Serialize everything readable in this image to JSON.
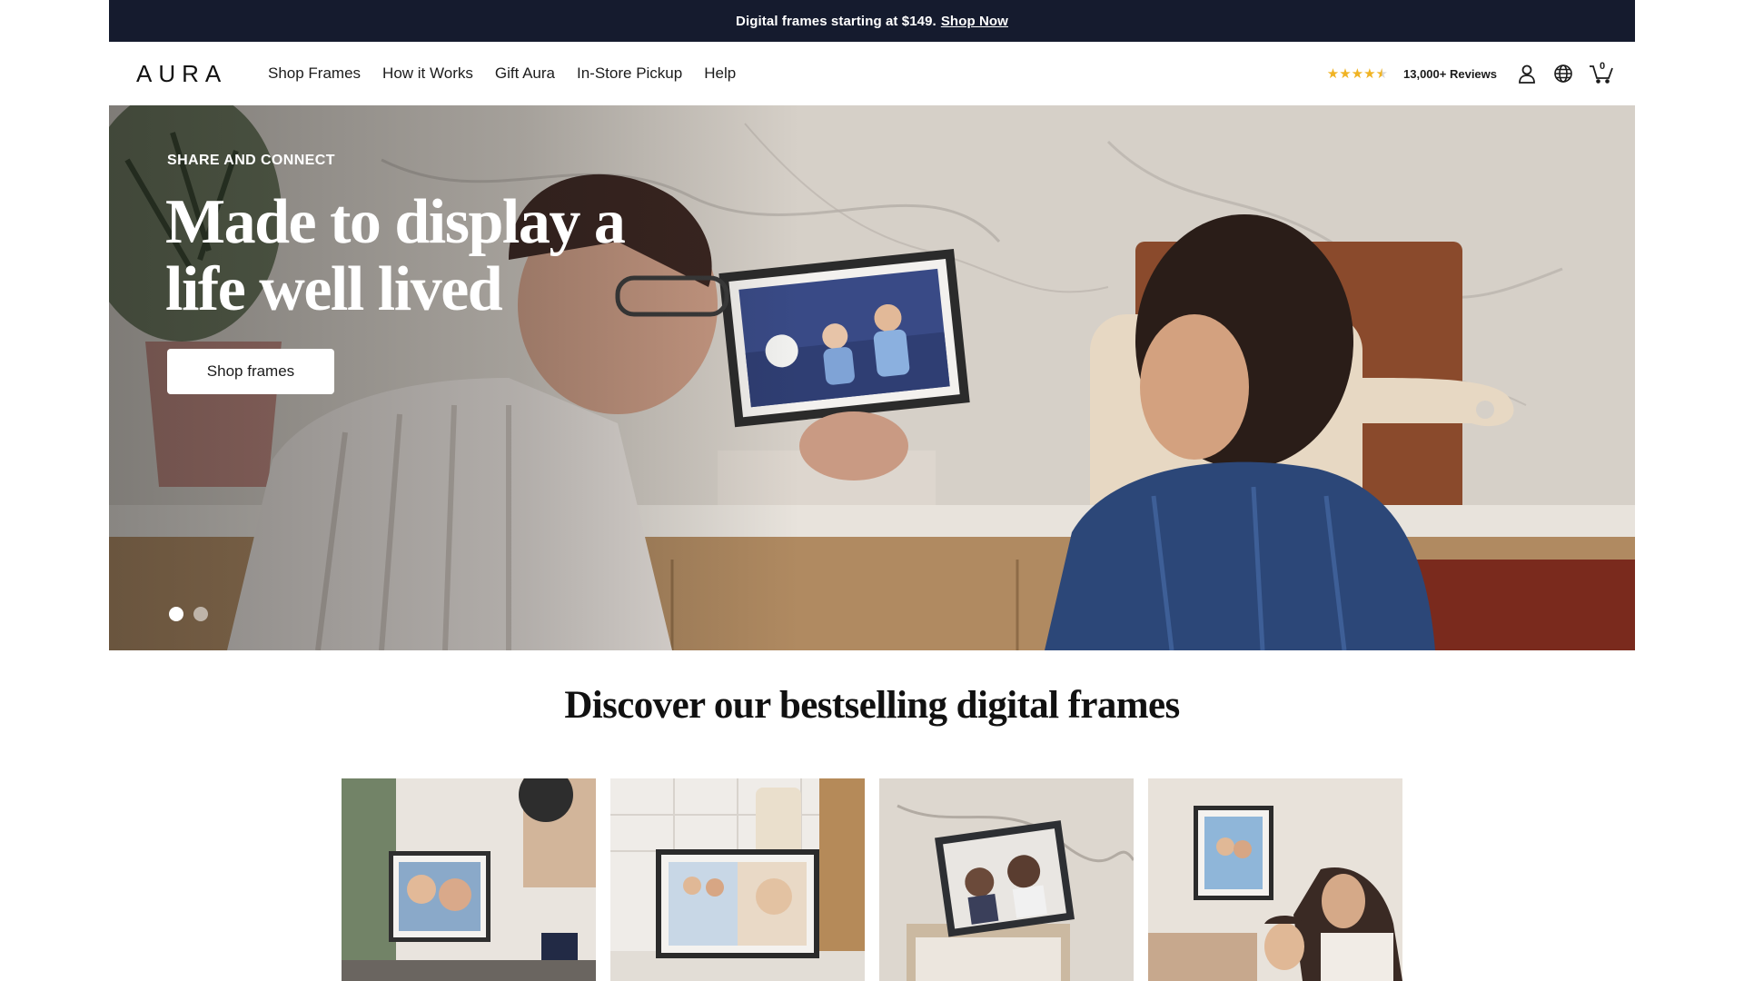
{
  "announcement": {
    "text": "Digital frames starting at $149.",
    "link": "Shop Now"
  },
  "header": {
    "logo": "AURA",
    "nav": [
      "Shop Frames",
      "How it Works",
      "Gift Aura",
      "In-Store Pickup",
      "Help"
    ],
    "rating_stars": 4.5,
    "reviews": "13,000+ Reviews",
    "cart_count": "0",
    "icons": [
      "star-icon",
      "user-icon",
      "globe-icon",
      "cart-icon"
    ]
  },
  "hero": {
    "eyebrow": "SHARE AND CONNECT",
    "title": "Made to display a life well lived",
    "cta": "Shop frames",
    "slides": 2,
    "active_slide": 1
  },
  "section": {
    "title": "Discover our bestselling digital frames"
  },
  "colors": {
    "announcement_bg": "#151b2e",
    "star": "#f0b323",
    "text": "#1b1b1b"
  }
}
